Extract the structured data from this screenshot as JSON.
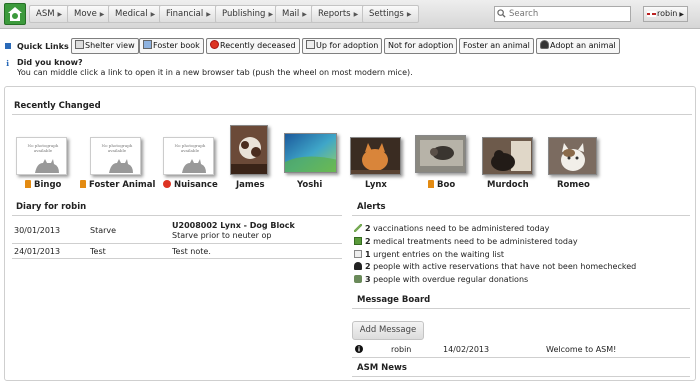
{
  "menu": {
    "items": [
      {
        "label": "ASM"
      },
      {
        "label": "Move"
      },
      {
        "label": "Medical"
      },
      {
        "label": "Financial"
      },
      {
        "label": "Publishing"
      },
      {
        "label": "Mail"
      },
      {
        "label": "Reports"
      },
      {
        "label": "Settings"
      }
    ],
    "search_placeholder": "Search",
    "user": "robin"
  },
  "quick_links": {
    "label": "Quick Links",
    "items": [
      {
        "label": "Shelter view",
        "icon": "shelter-icon"
      },
      {
        "label": "Foster book",
        "icon": "book-icon"
      },
      {
        "label": "Recently deceased",
        "icon": "deceased-icon"
      },
      {
        "label": "Up for adoption",
        "icon": "adoption-icon"
      },
      {
        "label": "Not for adoption",
        "icon": ""
      },
      {
        "label": "Foster an animal",
        "icon": ""
      },
      {
        "label": "Adopt an animal",
        "icon": "person-icon"
      }
    ]
  },
  "tip": {
    "title": "Did you know?",
    "text": "You can middle click a link to open it in a new browser tab (push the wheel on most modern mice)."
  },
  "recently_changed": {
    "heading": "Recently Changed",
    "no_photo_text": "No photograph available",
    "animals": [
      {
        "name": "Bingo",
        "photo": false,
        "flag": "orange"
      },
      {
        "name": "Foster Animal",
        "photo": false,
        "flag": "orange"
      },
      {
        "name": "Nuisance",
        "photo": false,
        "flag": "red"
      },
      {
        "name": "James",
        "photo": true,
        "flag": ""
      },
      {
        "name": "Yoshi",
        "photo": true,
        "flag": ""
      },
      {
        "name": "Lynx",
        "photo": true,
        "flag": ""
      },
      {
        "name": "Boo",
        "photo": true,
        "flag": "orange"
      },
      {
        "name": "Murdoch",
        "photo": true,
        "flag": ""
      },
      {
        "name": "Romeo",
        "photo": true,
        "flag": ""
      }
    ]
  },
  "diary": {
    "heading": "Diary for robin",
    "rows": [
      {
        "date": "30/01/2013",
        "by": "Starve",
        "subject": "U2008002 Lynx - Dog Block",
        "note": "Starve prior to neuter op"
      },
      {
        "date": "24/01/2013",
        "by": "Test",
        "subject": "",
        "note": "Test note."
      }
    ]
  },
  "alerts": {
    "heading": "Alerts",
    "rows": [
      {
        "count": "2",
        "text": "vaccinations need to be administered today"
      },
      {
        "count": "2",
        "text": "medical treatments need to be administered today"
      },
      {
        "count": "1",
        "text": "urgent entries on the waiting list"
      },
      {
        "count": "2",
        "text": "people with active reservations that have not been homechecked"
      },
      {
        "count": "3",
        "text": "people with overdue regular donations"
      }
    ]
  },
  "message_board": {
    "heading": "Message Board",
    "add_label": "Add Message",
    "messages": [
      {
        "user": "robin",
        "date": "14/02/2013",
        "text": "Welcome to ASM!"
      }
    ]
  },
  "news": {
    "heading": "ASM News"
  },
  "colors": {
    "accent_green": "#3c9a3c",
    "link_blue": "#2a6ab8",
    "flag_orange": "#e38b12",
    "flag_red": "#d32222"
  }
}
